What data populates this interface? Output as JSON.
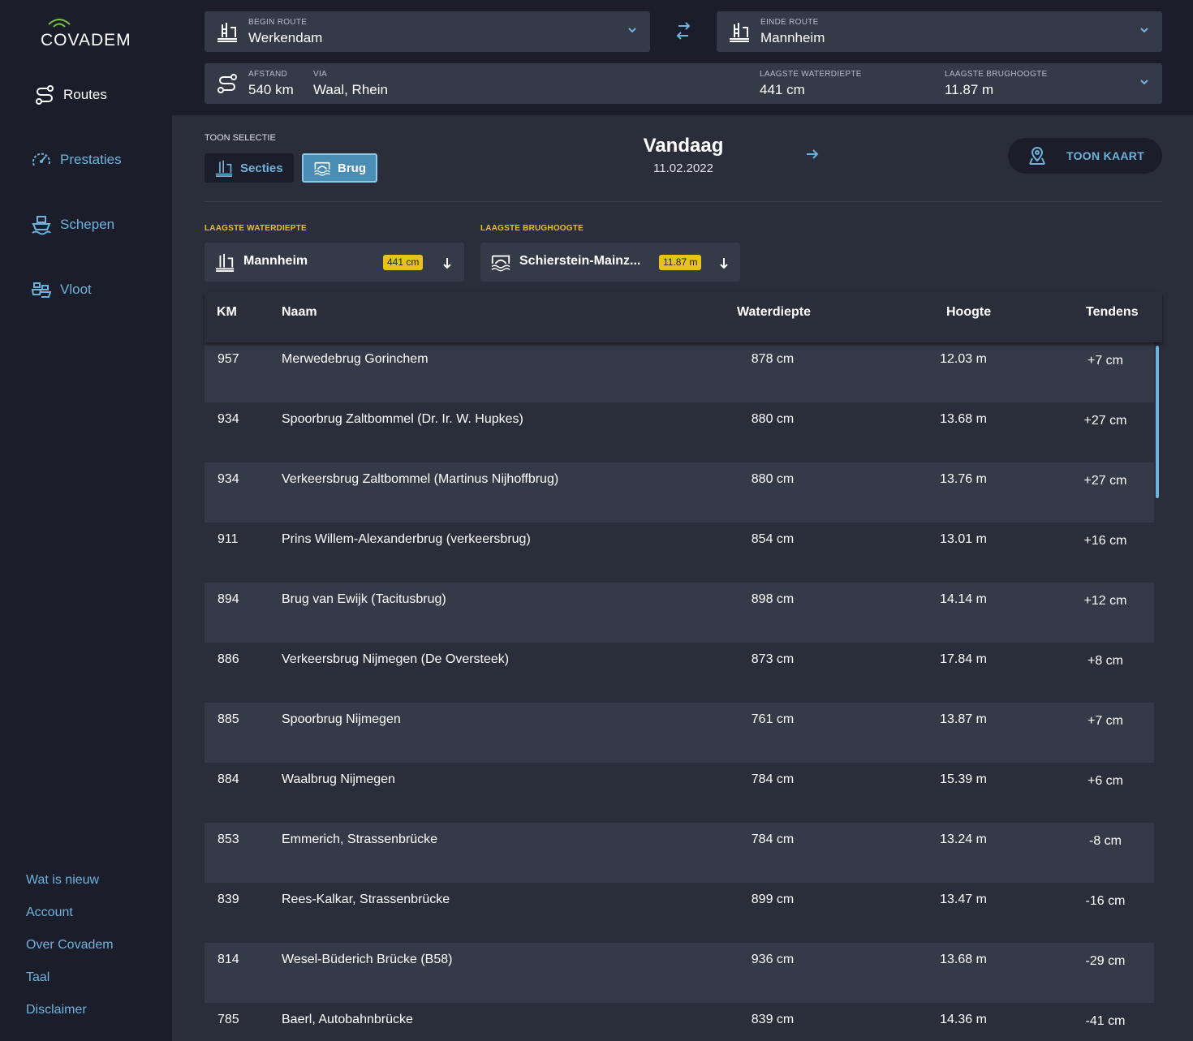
{
  "brand": {
    "name": "COVADEM"
  },
  "nav": [
    {
      "label": "Routes",
      "icon": "route-icon"
    },
    {
      "label": "Prestaties",
      "icon": "speedometer-icon"
    },
    {
      "label": "Schepen",
      "icon": "ship-icon"
    },
    {
      "label": "Vloot",
      "icon": "fleet-icon"
    }
  ],
  "footer_links": [
    "Wat is nieuw",
    "Account",
    "Over Covadem",
    "Taal",
    "Disclaimer"
  ],
  "route": {
    "begin_label": "BEGIN ROUTE",
    "begin_value": "Werkendam",
    "end_label": "EINDE ROUTE",
    "end_value": "Mannheim"
  },
  "info": {
    "afstand_label": "AFSTAND",
    "afstand_value": "540 km",
    "via_label": "VIA",
    "via_value": "Waal, Rhein",
    "waterdiepte_label": "LAAGSTE WATERDIEPTE",
    "waterdiepte_value": "441 cm",
    "brughoogte_label": "LAAGSTE BRUGHOOGTE",
    "brughoogte_value": "11.87 m"
  },
  "selection": {
    "label": "TOON SELECTIE",
    "secties": "Secties",
    "brug": "Brug"
  },
  "day": {
    "title": "Vandaag",
    "date": "11.02.2022"
  },
  "map_button": "TOON KAART",
  "lowest": {
    "water_label": "LAAGSTE WATERDIEPTE",
    "water_name": "Mannheim",
    "water_badge": "441 cm",
    "bridge_label": "LAAGSTE BRUGHOOGTE",
    "bridge_name": "Schierstein-Mainz...",
    "bridge_badge": "11.87 m"
  },
  "table": {
    "headers": {
      "km": "KM",
      "naam": "Naam",
      "waterdiepte": "Waterdiepte",
      "hoogte": "Hoogte",
      "tendens": "Tendens"
    },
    "rows": [
      {
        "km": "957",
        "naam": "Merwedebrug Gorinchem",
        "waterdiepte": "878 cm",
        "hoogte": "12.03 m",
        "tendens": "+7 cm"
      },
      {
        "km": "934",
        "naam": "Spoorbrug Zaltbommel (Dr. Ir. W. Hupkes)",
        "waterdiepte": "880 cm",
        "hoogte": "13.68 m",
        "tendens": "+27 cm"
      },
      {
        "km": "934",
        "naam": "Verkeersbrug Zaltbommel (Martinus Nijhoffbrug)",
        "waterdiepte": "880 cm",
        "hoogte": "13.76 m",
        "tendens": "+27 cm"
      },
      {
        "km": "911",
        "naam": "Prins Willem-Alexanderbrug (verkeersbrug)",
        "waterdiepte": "854 cm",
        "hoogte": "13.01 m",
        "tendens": "+16 cm"
      },
      {
        "km": "894",
        "naam": "Brug van Ewijk (Tacitusbrug)",
        "waterdiepte": "898 cm",
        "hoogte": "14.14 m",
        "tendens": "+12 cm"
      },
      {
        "km": "886",
        "naam": "Verkeersbrug Nijmegen (De Oversteek)",
        "waterdiepte": "873 cm",
        "hoogte": "17.84 m",
        "tendens": "+8 cm"
      },
      {
        "km": "885",
        "naam": "Spoorbrug Nijmegen",
        "waterdiepte": "761 cm",
        "hoogte": "13.87 m",
        "tendens": "+7 cm"
      },
      {
        "km": "884",
        "naam": "Waalbrug Nijmegen",
        "waterdiepte": "784 cm",
        "hoogte": "15.39 m",
        "tendens": "+6 cm"
      },
      {
        "km": "853",
        "naam": "Emmerich, Strassenbrücke",
        "waterdiepte": "784 cm",
        "hoogte": "13.24 m",
        "tendens": "-8 cm"
      },
      {
        "km": "839",
        "naam": "Rees-Kalkar, Strassenbrücke",
        "waterdiepte": "899 cm",
        "hoogte": "13.47 m",
        "tendens": "-16 cm"
      },
      {
        "km": "814",
        "naam": "Wesel-Büderich Brücke (B58)",
        "waterdiepte": "936 cm",
        "hoogte": "13.68 m",
        "tendens": "-29 cm"
      },
      {
        "km": "785",
        "naam": "Baerl, Autobahnbrücke",
        "waterdiepte": "839 cm",
        "hoogte": "14.36 m",
        "tendens": "-41 cm"
      }
    ]
  },
  "colors": {
    "accent": "#6fb3dc",
    "highlight": "#e8c21a",
    "sidebar": "#1b1d2a",
    "panel": "#353a48"
  }
}
